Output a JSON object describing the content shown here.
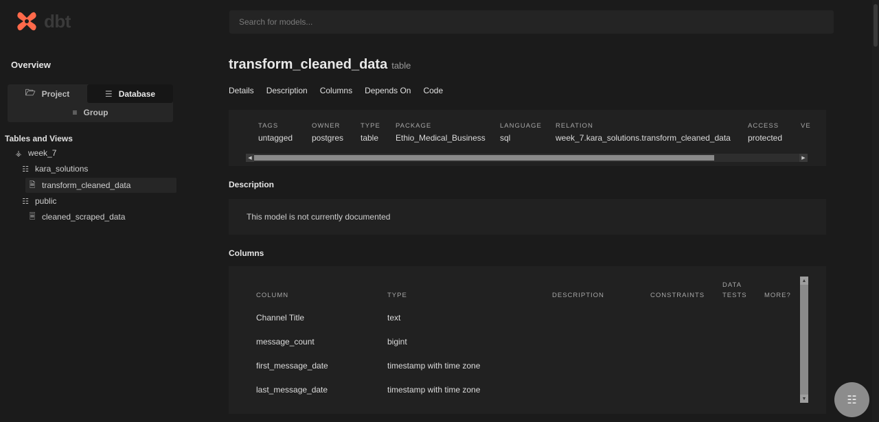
{
  "brand": {
    "logo_text": "dbt",
    "accent": "#ff694a"
  },
  "sidebar": {
    "overview": "Overview",
    "switch": {
      "project": "Project",
      "database": "Database",
      "group": "Group"
    },
    "tables_title": "Tables and Views",
    "tree": [
      {
        "label": "week_7",
        "icon": "database-icon"
      },
      {
        "label": "kara_solutions",
        "icon": "schema-tree-icon"
      },
      {
        "label": "transform_cleaned_data",
        "icon": "file-icon",
        "selected": true
      },
      {
        "label": "public",
        "icon": "schema-tree-icon"
      },
      {
        "label": "cleaned_scraped_data",
        "icon": "file-outline-icon"
      }
    ]
  },
  "search": {
    "placeholder": "Search for models..."
  },
  "model": {
    "name": "transform_cleaned_data",
    "kind": "table"
  },
  "tabs": [
    "Details",
    "Description",
    "Columns",
    "Depends On",
    "Code"
  ],
  "details": [
    {
      "label": "Tags",
      "value": "untagged"
    },
    {
      "label": "Owner",
      "value": "postgres"
    },
    {
      "label": "Type",
      "value": "table"
    },
    {
      "label": "Package",
      "value": "Ethio_Medical_Business"
    },
    {
      "label": "Language",
      "value": "sql"
    },
    {
      "label": "Relation",
      "value": "week_7.kara_solutions.transform_cleaned_data"
    },
    {
      "label": "Access",
      "value": "protected"
    },
    {
      "label": "Ve",
      "value": ""
    }
  ],
  "description": {
    "title": "Description",
    "text": "This model is not currently documented"
  },
  "columns": {
    "title": "Columns",
    "headers": {
      "column": "Column",
      "type": "Type",
      "description": "Description",
      "constraints": "Constraints",
      "data_tests_1": "Data",
      "data_tests_2": "Tests",
      "more": "More?"
    },
    "rows": [
      {
        "name": "Channel Title",
        "type": "text"
      },
      {
        "name": "message_count",
        "type": "bigint"
      },
      {
        "name": "first_message_date",
        "type": "timestamp with time zone"
      },
      {
        "name": "last_message_date",
        "type": "timestamp with time zone"
      }
    ]
  }
}
